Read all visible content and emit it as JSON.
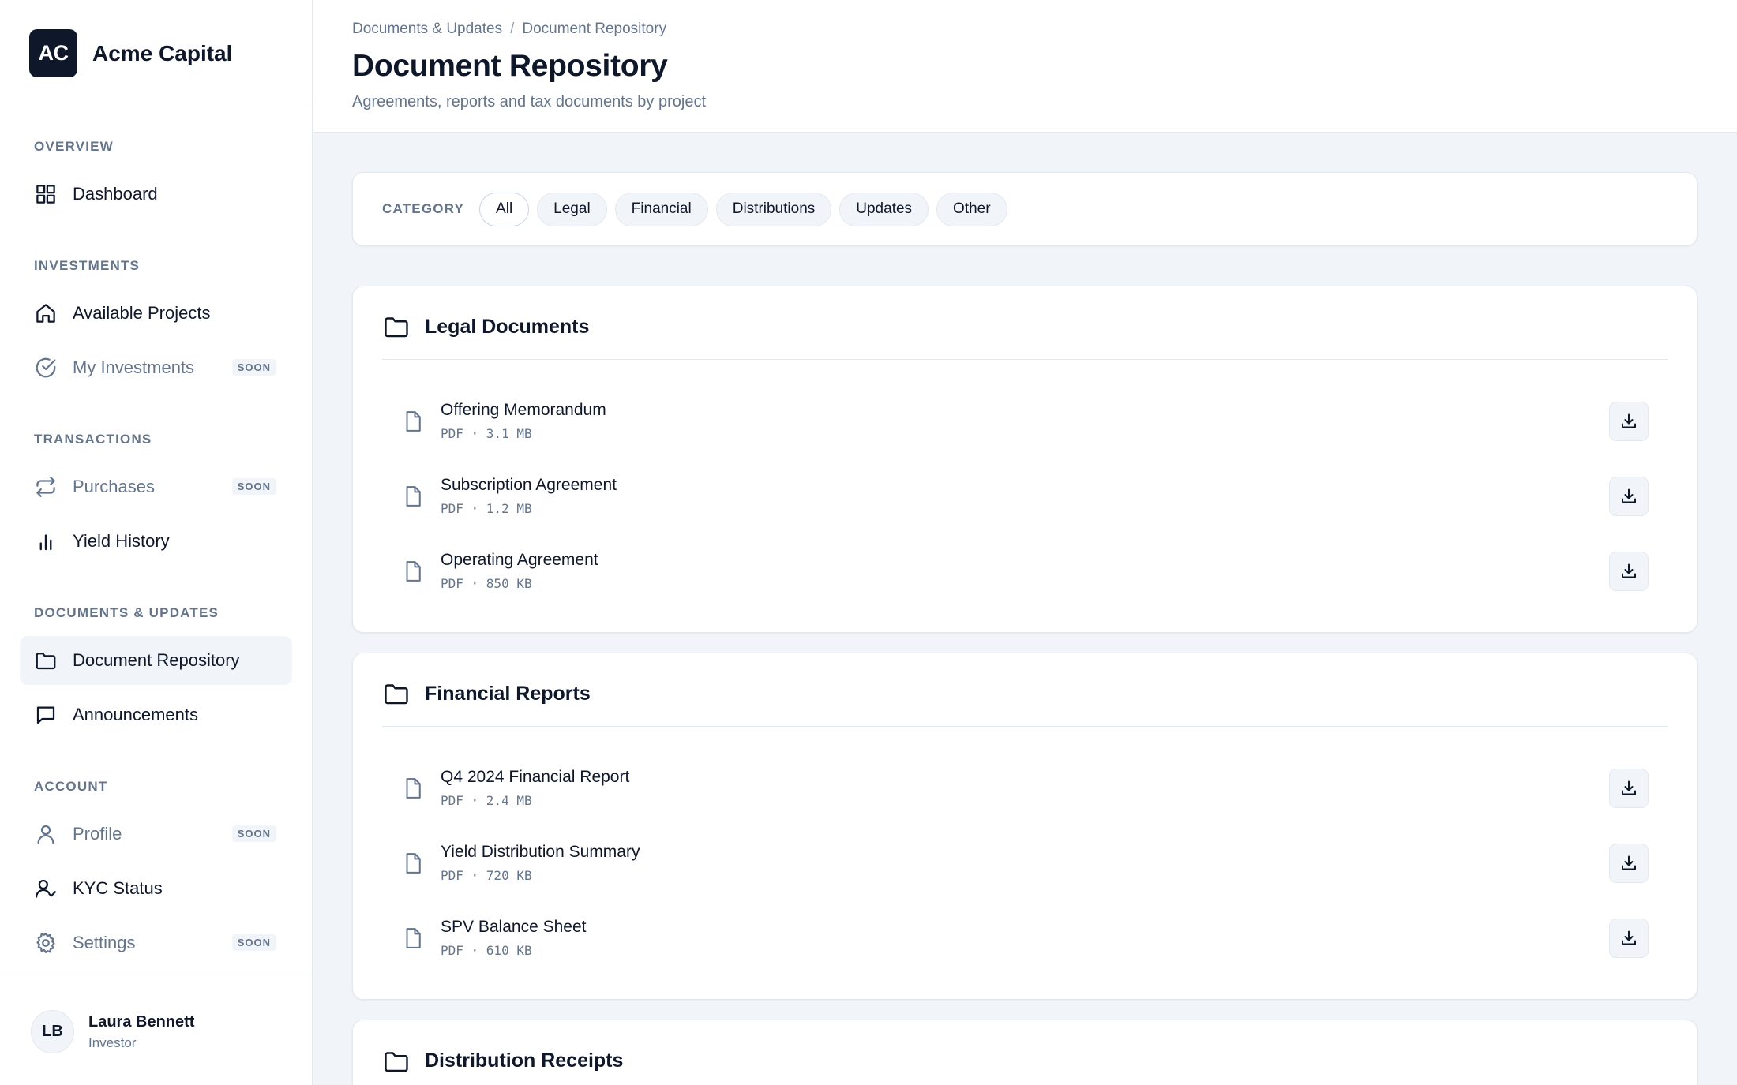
{
  "brand": {
    "logo": "AC",
    "name": "Acme Capital"
  },
  "sidebar": {
    "sections": [
      {
        "title": "OVERVIEW",
        "items": [
          {
            "label": "Dashboard",
            "icon": "grid-icon"
          }
        ]
      },
      {
        "title": "INVESTMENTS",
        "items": [
          {
            "label": "Available Projects",
            "icon": "home-icon"
          },
          {
            "label": "My Investments",
            "icon": "check-circle-icon",
            "badge": "SOON"
          }
        ]
      },
      {
        "title": "TRANSACTIONS",
        "items": [
          {
            "label": "Purchases",
            "icon": "repeat-icon",
            "badge": "SOON"
          },
          {
            "label": "Yield History",
            "icon": "bar-chart-icon"
          }
        ]
      },
      {
        "title": "DOCUMENTS & UPDATES",
        "items": [
          {
            "label": "Document Repository",
            "icon": "folder-icon",
            "active": true
          },
          {
            "label": "Announcements",
            "icon": "message-icon"
          }
        ]
      },
      {
        "title": "ACCOUNT",
        "items": [
          {
            "label": "Profile",
            "icon": "user-icon",
            "badge": "SOON"
          },
          {
            "label": "KYC Status",
            "icon": "user-check-icon"
          },
          {
            "label": "Settings",
            "icon": "gear-icon",
            "badge": "SOON"
          }
        ]
      }
    ]
  },
  "user": {
    "initials": "LB",
    "name": "Laura Bennett",
    "role": "Investor"
  },
  "header": {
    "breadcrumb": [
      "Documents & Updates",
      "Document Repository"
    ],
    "breadcrumb_sep": "/",
    "title": "Document Repository",
    "subtitle": "Agreements, reports and tax documents by project"
  },
  "filter": {
    "label": "CATEGORY",
    "chips": [
      "All",
      "Legal",
      "Financial",
      "Distributions",
      "Updates",
      "Other"
    ],
    "selected": "All"
  },
  "sections": [
    {
      "title": "Legal Documents",
      "docs": [
        {
          "name": "Offering Memorandum",
          "meta": "PDF · 3.1 MB"
        },
        {
          "name": "Subscription Agreement",
          "meta": "PDF · 1.2 MB"
        },
        {
          "name": "Operating Agreement",
          "meta": "PDF · 850 KB"
        }
      ]
    },
    {
      "title": "Financial Reports",
      "docs": [
        {
          "name": "Q4 2024 Financial Report",
          "meta": "PDF · 2.4 MB"
        },
        {
          "name": "Yield Distribution Summary",
          "meta": "PDF · 720 KB"
        },
        {
          "name": "SPV Balance Sheet",
          "meta": "PDF · 610 KB"
        }
      ]
    },
    {
      "title": "Distribution Receipts",
      "docs": []
    }
  ],
  "colors": {
    "accent": "#0f172a",
    "muted": "#64748b",
    "border": "#e2e8f0",
    "background": "#f1f5f9"
  }
}
